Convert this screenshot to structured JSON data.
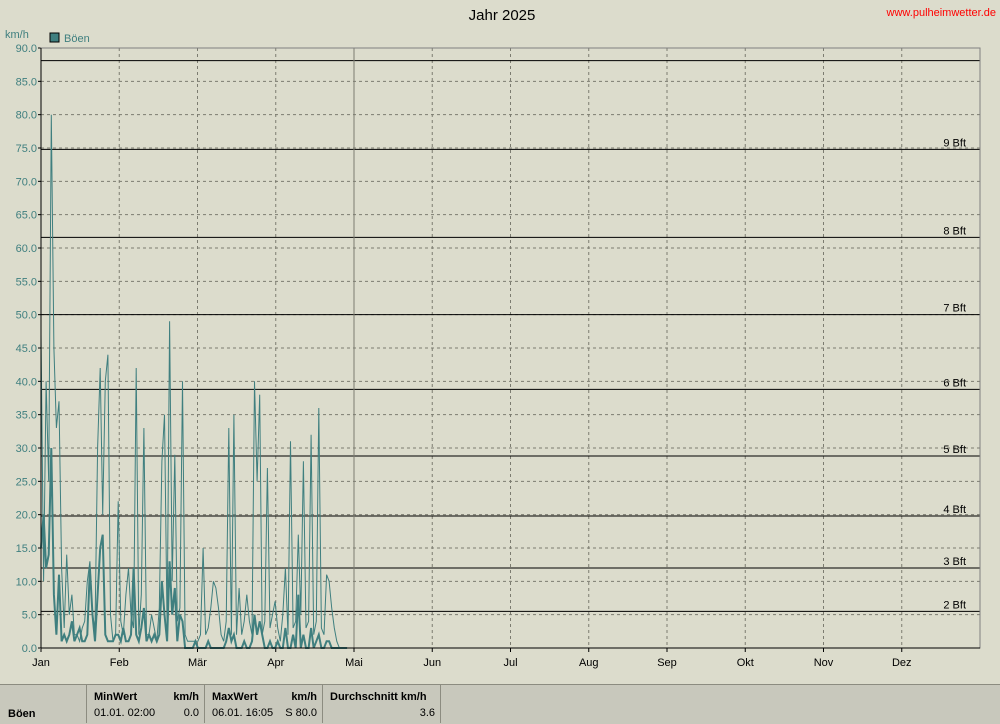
{
  "site": "www.pulheimwetter.de",
  "chart_data": {
    "type": "line",
    "title": "Jahr 2025",
    "ylabel": "km/h",
    "legend": "Böen",
    "legend_position": "top-left",
    "grid": true,
    "ylim": [
      0,
      90
    ],
    "ytick_labels": [
      "0.0",
      "5.0",
      "10.0",
      "15.0",
      "20.0",
      "25.0",
      "30.0",
      "35.0",
      "40.0",
      "45.0",
      "50.0",
      "55.0",
      "60.0",
      "65.0",
      "70.0",
      "75.0",
      "80.0",
      "85.0",
      "90.0"
    ],
    "months": [
      "Jan",
      "Feb",
      "Mär",
      "Apr",
      "Mai",
      "Jun",
      "Jul",
      "Aug",
      "Sep",
      "Okt",
      "Nov",
      "Dez"
    ],
    "beaufort": [
      {
        "label": "2 Bft",
        "value": 5.5
      },
      {
        "label": "3 Bft",
        "value": 12
      },
      {
        "label": "4 Bft",
        "value": 19.8
      },
      {
        "label": "5 Bft",
        "value": 28.8
      },
      {
        "label": "6 Bft",
        "value": 38.8
      },
      {
        "label": "7 Bft",
        "value": 50
      },
      {
        "label": "8 Bft",
        "value": 61.6
      },
      {
        "label": "9 Bft",
        "value": 74.8
      },
      {
        "label": "",
        "value": 88.1
      }
    ],
    "series": [
      {
        "name": "Böen",
        "color": "#3f7f7f",
        "x": [
          0,
          1,
          2,
          3,
          4,
          5,
          6,
          7,
          8,
          9,
          10,
          11,
          12,
          13,
          14,
          15,
          16,
          17,
          18,
          19,
          20,
          21,
          22,
          23,
          24,
          25,
          26,
          27,
          28,
          29,
          30,
          31,
          32,
          33,
          34,
          35,
          36,
          37,
          38,
          39,
          40,
          41,
          42,
          43,
          44,
          45,
          46,
          47,
          48,
          49,
          50,
          51,
          52,
          53,
          54,
          55,
          56,
          57,
          58,
          59,
          60,
          61,
          62,
          63,
          64,
          65,
          66,
          67,
          68,
          69,
          70,
          71,
          72,
          73,
          74,
          75,
          76,
          77,
          78,
          79,
          80,
          81,
          82,
          83,
          84,
          85,
          86,
          87,
          88,
          89,
          90,
          91,
          92,
          93,
          94,
          95,
          96,
          97,
          98,
          99,
          100,
          101,
          102,
          103,
          104,
          105,
          106,
          107,
          108,
          109,
          110,
          111,
          112,
          113,
          114,
          115,
          116,
          117,
          118,
          119
        ],
        "y": [
          47,
          10,
          40,
          25,
          80,
          45,
          33,
          37,
          12,
          3,
          14,
          5,
          8,
          2,
          2,
          1,
          3,
          4,
          10,
          13,
          5,
          3,
          30,
          42,
          20,
          40,
          44,
          5,
          1,
          2,
          22,
          4,
          2,
          8,
          12,
          5,
          3,
          42,
          2,
          8,
          33,
          2,
          2,
          5,
          3,
          1,
          6,
          28,
          35,
          3,
          49,
          10,
          29,
          4,
          6,
          40,
          2,
          1,
          1,
          1,
          1,
          1,
          2,
          15,
          2,
          3,
          6,
          10,
          9,
          6,
          2,
          1,
          4,
          33,
          2,
          35,
          2,
          9,
          2,
          4,
          8,
          4,
          2,
          40,
          25,
          38,
          2,
          4,
          27,
          3,
          5,
          7,
          3,
          1,
          5,
          12,
          2,
          31,
          3,
          4,
          17,
          5,
          28,
          3,
          4,
          32,
          2,
          4,
          36,
          3,
          2,
          11,
          10,
          6,
          3,
          1,
          0,
          0,
          0,
          0
        ],
        "y2": [
          15,
          20,
          12,
          14,
          30,
          8,
          2,
          11,
          1,
          2,
          1,
          2,
          4,
          1,
          2,
          3,
          1,
          1,
          2,
          12,
          5,
          1,
          8,
          15,
          17,
          2,
          1,
          1,
          1,
          2,
          2,
          1,
          3,
          1,
          1,
          2,
          12,
          2,
          1,
          3,
          6,
          1,
          2,
          1,
          2,
          1,
          2,
          10,
          5,
          1,
          13,
          5,
          9,
          1,
          5,
          4,
          0,
          0,
          0,
          0,
          1,
          0,
          0,
          0,
          0,
          1,
          0,
          0,
          0,
          0,
          0,
          0,
          1,
          3,
          1,
          2,
          0,
          0,
          0,
          1,
          0,
          0,
          1,
          5,
          2,
          4,
          2,
          0,
          0,
          1,
          0,
          0,
          1,
          0,
          0,
          3,
          0,
          0,
          2,
          0,
          8,
          0,
          2,
          0,
          0,
          3,
          0,
          1,
          2,
          0,
          0,
          1,
          1,
          0,
          0,
          0,
          0,
          0,
          0,
          0
        ]
      }
    ]
  },
  "footer": {
    "row_label": "Böen",
    "min_label": "MinWert",
    "min_unit": "km/h",
    "min_date": "01.01.  02:00",
    "min_value": "0.0",
    "max_label": "MaxWert",
    "max_unit": "km/h",
    "max_date": "06.01.  16:05",
    "max_value": "S 80.0",
    "avg_label": "Durchschnitt km/h",
    "avg_value": "3.6"
  }
}
